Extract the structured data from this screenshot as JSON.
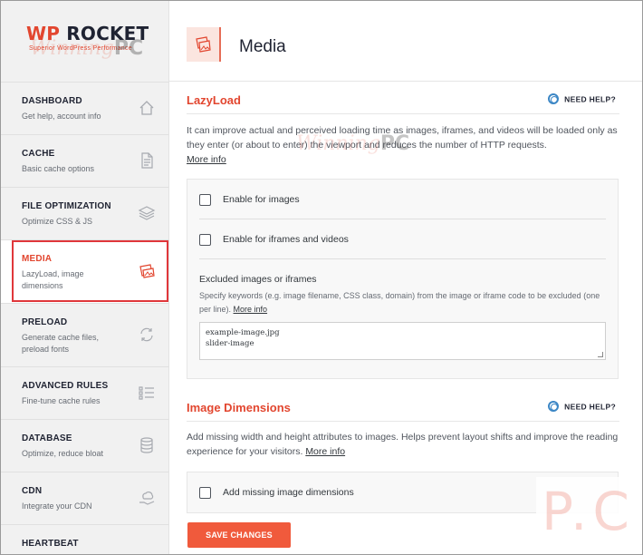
{
  "logo": {
    "brand_wp": "WP",
    "brand_rocket": "ROCKET",
    "tagline": "Superior WordPress Performance",
    "watermark_script": "Winning",
    "watermark_pc": "PC"
  },
  "sidebar": {
    "items": [
      {
        "title": "DASHBOARD",
        "desc": "Get help, account info",
        "icon": "home-icon"
      },
      {
        "title": "CACHE",
        "desc": "Basic cache options",
        "icon": "document-icon"
      },
      {
        "title": "FILE OPTIMIZATION",
        "desc": "Optimize CSS & JS",
        "icon": "layers-icon"
      },
      {
        "title": "MEDIA",
        "desc": "LazyLoad, image dimensions",
        "icon": "images-icon"
      },
      {
        "title": "PRELOAD",
        "desc": "Generate cache files, preload fonts",
        "icon": "refresh-icon"
      },
      {
        "title": "ADVANCED RULES",
        "desc": "Fine-tune cache rules",
        "icon": "list-icon"
      },
      {
        "title": "DATABASE",
        "desc": "Optimize, reduce bloat",
        "icon": "database-icon"
      },
      {
        "title": "CDN",
        "desc": "Integrate your CDN",
        "icon": "cloud-hand-icon"
      },
      {
        "title": "HEARTBEAT",
        "desc": "",
        "icon": "heart-icon"
      }
    ]
  },
  "main": {
    "title": "Media",
    "lazyload": {
      "heading": "LazyLoad",
      "help": "NEED HELP?",
      "intro": "It can improve actual and perceived loading time as images, iframes, and videos will be loaded only as they enter (or about to enter) the viewport and reduces the number of HTTP requests.",
      "more": "More info",
      "opt_images": "Enable for images",
      "opt_iframes": "Enable for iframes and videos",
      "excluded_heading": "Excluded images or iframes",
      "excluded_desc": "Specify keywords (e.g. image filename, CSS class, domain) from the image or iframe code to be excluded (one per line).",
      "excluded_more": "More info",
      "excluded_value_1": "example-image.jpg",
      "excluded_value_2": "slider-image"
    },
    "dimensions": {
      "heading": "Image Dimensions",
      "help": "NEED HELP?",
      "intro": "Add missing width and height attributes to images. Helps prevent layout shifts and improve the reading experience for your visitors.",
      "more": "More info",
      "opt_missing": "Add missing image dimensions"
    },
    "save_label": "SAVE CHANGES"
  },
  "watermark": {
    "script": "Winning",
    "pc": "PC",
    "corner": "P.C"
  },
  "colors": {
    "accent": "#e2462f",
    "button": "#f05a3c",
    "help_ring": "#3b86c5"
  }
}
